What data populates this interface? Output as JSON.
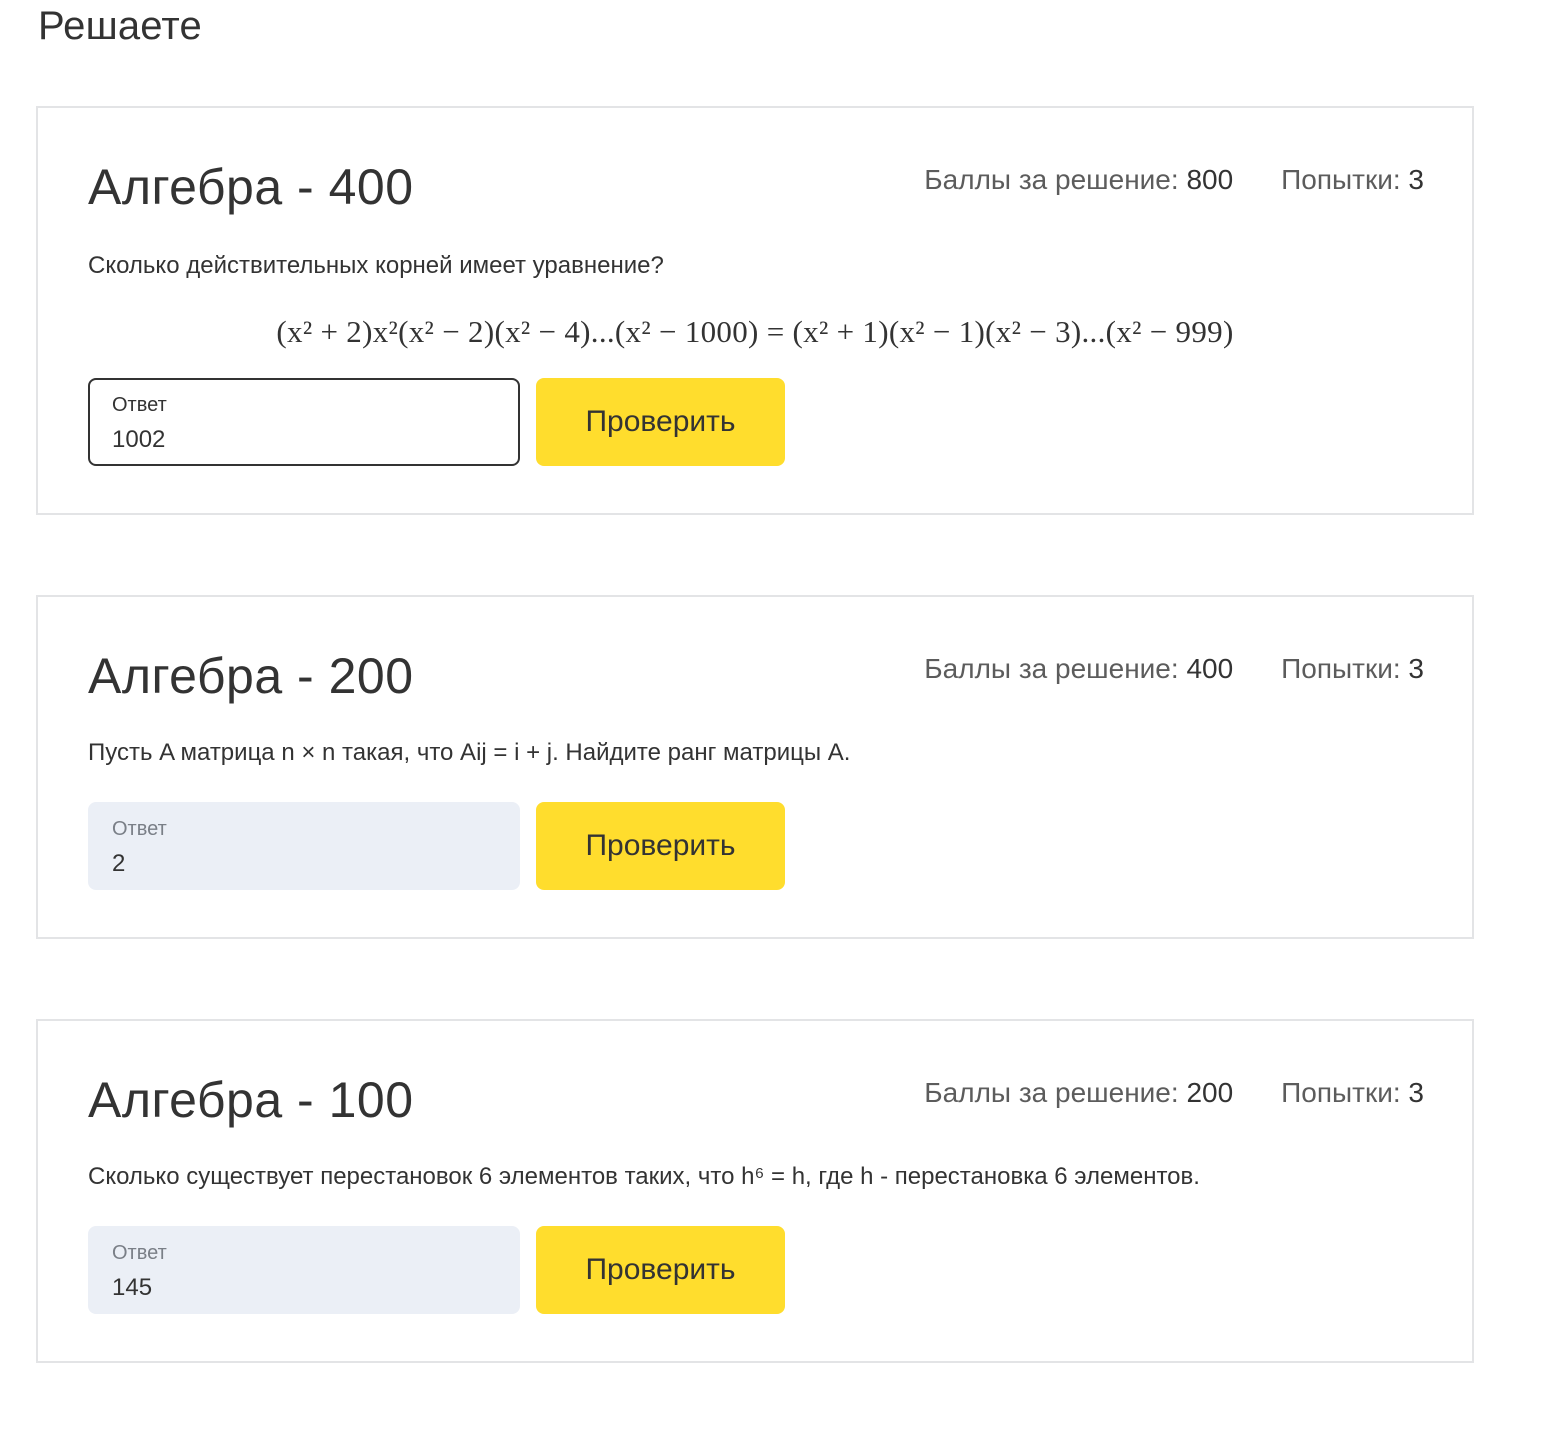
{
  "page": {
    "heading": "Решаете"
  },
  "tasks": [
    {
      "title": "Алгебра - 400",
      "points_label": "Баллы за решение:",
      "points_value": "800",
      "attempts_label": "Попытки:",
      "attempts_value": "3",
      "question": "Сколько действительных корней имеет уравнение?",
      "formula": "(x² + 2)x²(x² − 2)(x² − 4)...(x² − 1000) = (x² + 1)(x² − 1)(x² − 3)...(x² − 999)",
      "answer_label": "Ответ",
      "answer_value": "1002",
      "check_label": "Проверить"
    },
    {
      "title": "Алгебра - 200",
      "points_label": "Баллы за решение:",
      "points_value": "400",
      "attempts_label": "Попытки:",
      "attempts_value": "3",
      "question": "Пусть A матрица n × n такая, что Aij = i + j. Найдите ранг матрицы A.",
      "answer_label": "Ответ",
      "answer_value": "2",
      "check_label": "Проверить"
    },
    {
      "title": "Алгебра - 100",
      "points_label": "Баллы за решение:",
      "points_value": "200",
      "attempts_label": "Попытки:",
      "attempts_value": "3",
      "question": "Сколько существует перестановок 6 элементов таких, что h⁶ = h, где h - перестановка 6 элементов.",
      "answer_label": "Ответ",
      "answer_value": "145",
      "check_label": "Проверить"
    }
  ],
  "colors": {
    "button_bg": "#ffdd2d",
    "field_bg": "#ebeff6",
    "card_border": "#e3e4e6",
    "text": "#333333",
    "muted_text": "#5c5c5c"
  }
}
